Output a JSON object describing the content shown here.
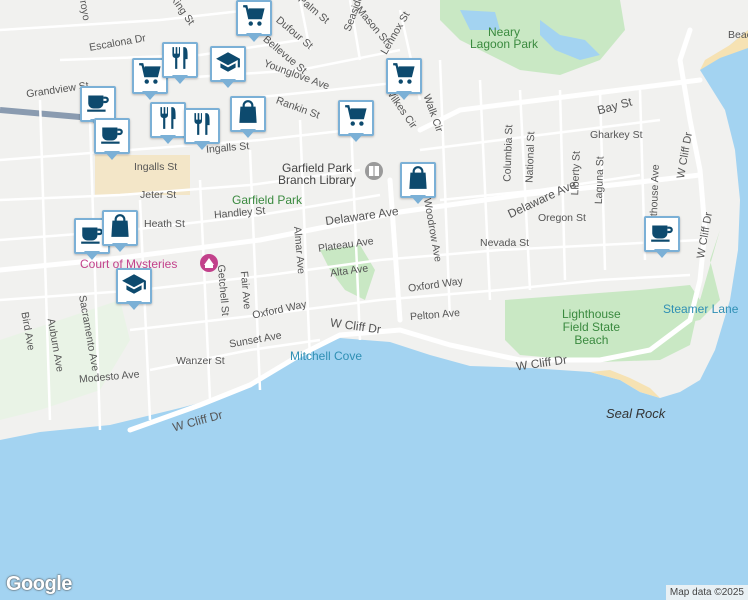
{
  "colors": {
    "water": "#a3d3f1",
    "land": "#f1f1ef",
    "park": "#c9e8c4",
    "sand": "#f6e2b3",
    "road": "#ffffff",
    "marker_border": "#7bb0d6",
    "marker_icon": "#0d4a6e",
    "poi_pink": "#c2418b"
  },
  "map": {
    "streets": [
      "Escalona Dr",
      "King St",
      "Palm St",
      "Seaside",
      "Mason St",
      "Dufour St",
      "Bellevue St",
      "Lennox St",
      "Younglove Ave",
      "Grandview St",
      "Rankin St",
      "Wilkes Cir",
      "Walk Cir",
      "Columbia St",
      "National St",
      "Bay St",
      "Gharkey St",
      "Liberty St",
      "Laguna St",
      "Lighthouse Ave",
      "W Cliff Dr",
      "Ingalls St",
      "Jeter St",
      "Handley St",
      "Heath St",
      "Delaware Ave",
      "Oregon St",
      "Nevada St",
      "Plateau Ave",
      "Woodrow Ave",
      "Alta Ave",
      "Oxford Way",
      "Pelton Ave",
      "Almar Ave",
      "Fair Ave",
      "Getchell St",
      "Sunset Ave",
      "Wanzer St",
      "Modesto Ave",
      "Sacramento Ave",
      "Auburn Ave",
      "Bird Ave",
      "Arroyo",
      "Beach"
    ],
    "places": {
      "neary_lagoon": "Neary\nLagoon Park",
      "library": "Garfield Park\nBranch Library",
      "garfield_park": "Garfield Park",
      "court_of_mysteries": "Court of Mysteries",
      "mitchell_cove": "Mitchell Cove",
      "lighthouse_beach": "Lighthouse\nField State\nBeach",
      "steamer_lane": "Steamer Lane",
      "seal_rock": "Seal Rock"
    }
  },
  "markers": [
    {
      "icon": "shopping-cart-icon"
    },
    {
      "icon": "shopping-cart-icon"
    },
    {
      "icon": "shopping-cart-icon"
    },
    {
      "icon": "shopping-cart-icon"
    },
    {
      "icon": "coffee-icon"
    },
    {
      "icon": "coffee-icon"
    },
    {
      "icon": "coffee-icon"
    },
    {
      "icon": "coffee-icon"
    },
    {
      "icon": "restaurant-icon"
    },
    {
      "icon": "restaurant-icon"
    },
    {
      "icon": "restaurant-icon"
    },
    {
      "icon": "school-icon"
    },
    {
      "icon": "school-icon"
    },
    {
      "icon": "shopping-bag-icon"
    },
    {
      "icon": "shopping-bag-icon"
    },
    {
      "icon": "shopping-bag-icon"
    }
  ],
  "footer": {
    "logo": "Google",
    "attribution": "Map data ©2025"
  }
}
